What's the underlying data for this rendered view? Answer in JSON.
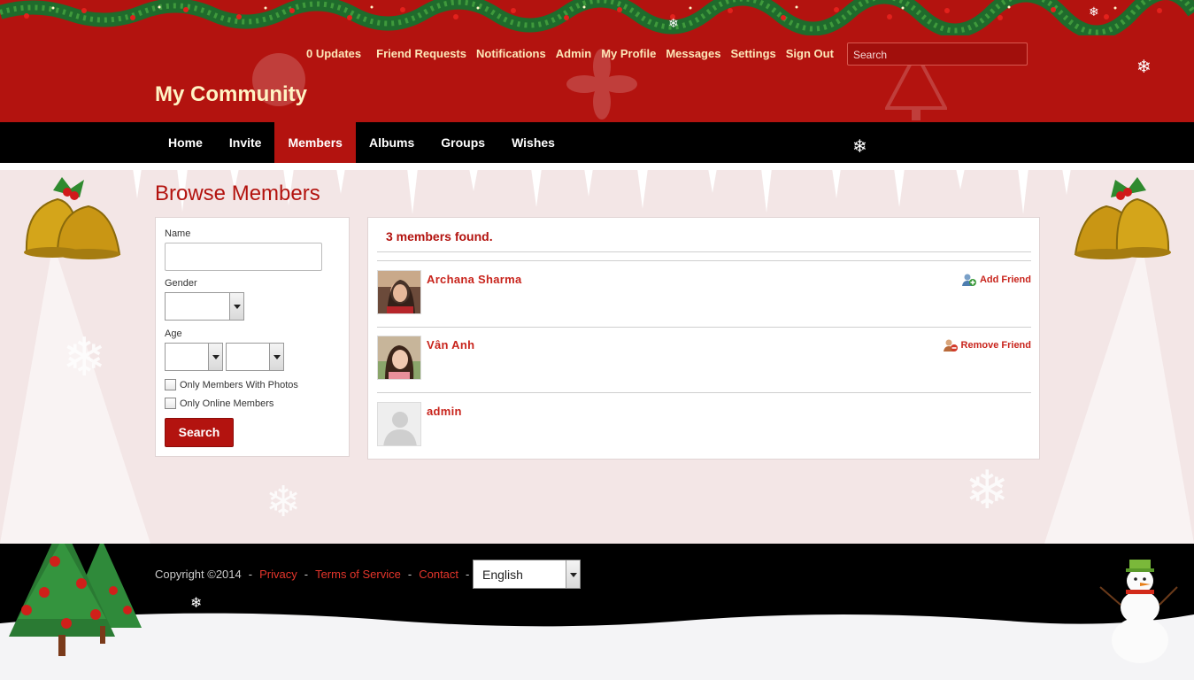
{
  "header": {
    "site_title": "My Community",
    "search_placeholder": "Search",
    "mini_menu": [
      {
        "label": "0 Updates"
      },
      {
        "label": "Friend Requests"
      },
      {
        "label": "Notifications"
      },
      {
        "label": "Admin"
      },
      {
        "label": "My Profile"
      },
      {
        "label": "Messages"
      },
      {
        "label": "Settings"
      },
      {
        "label": "Sign Out"
      }
    ]
  },
  "nav": {
    "items": [
      {
        "label": "Home"
      },
      {
        "label": "Invite"
      },
      {
        "label": "Members"
      },
      {
        "label": "Albums"
      },
      {
        "label": "Groups"
      },
      {
        "label": "Wishes"
      }
    ],
    "active": "Members"
  },
  "page": {
    "title": "Browse Members"
  },
  "filter": {
    "name_label": "Name",
    "name_value": "",
    "gender_label": "Gender",
    "gender_value": "",
    "age_label": "Age",
    "age_from_value": "",
    "age_to_value": "",
    "photos_label": "Only Members With Photos",
    "online_label": "Only Online Members",
    "search_button": "Search"
  },
  "members": {
    "found_text": "3 members found.",
    "list": [
      {
        "name": "Archana  Sharma",
        "action": "Add Friend",
        "action_icon": "add-friend-icon",
        "avatar": "photo"
      },
      {
        "name": "Vân Anh",
        "action": "Remove Friend",
        "action_icon": "remove-friend-icon",
        "avatar": "photo"
      },
      {
        "name": "admin",
        "action": "",
        "action_icon": "",
        "avatar": "placeholder"
      }
    ]
  },
  "footer": {
    "copyright": "Copyright ©2014",
    "links": [
      {
        "label": "Privacy"
      },
      {
        "label": "Terms of Service"
      },
      {
        "label": "Contact"
      }
    ],
    "language": "English"
  },
  "colors": {
    "header_red": "#b3130f",
    "nav_black": "#000000",
    "link_red": "#c8241c",
    "menu_text": "#fde7b8",
    "title_cream": "#fff3c4"
  }
}
